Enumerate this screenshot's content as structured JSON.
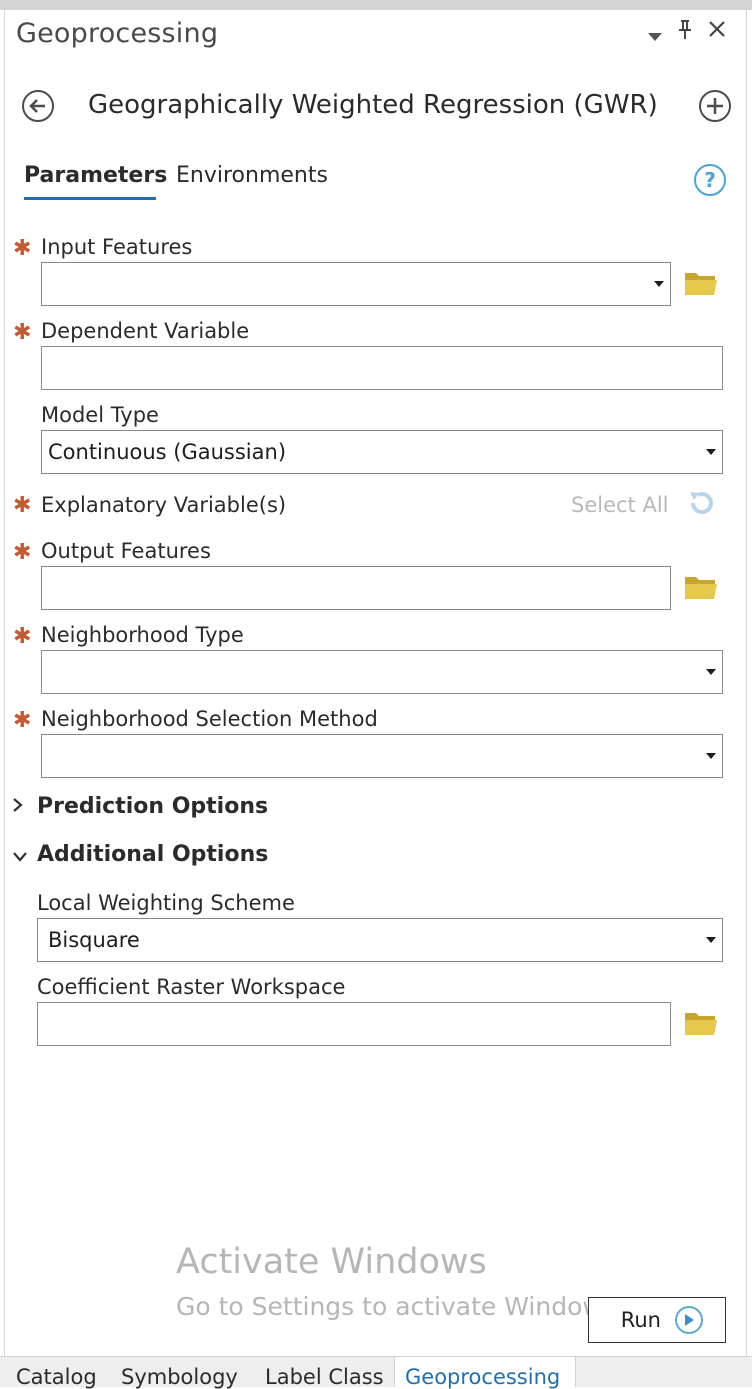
{
  "pane": {
    "title": "Geoprocessing",
    "controls": [
      "dropdown-icon",
      "pin-icon",
      "close-icon"
    ]
  },
  "tool": {
    "title": "Geographically Weighted Regression (GWR)"
  },
  "tabs": {
    "parameters": "Parameters",
    "environments": "Environments",
    "active": "Parameters"
  },
  "help_symbol": "?",
  "parameters": {
    "input_features": {
      "label": "Input Features",
      "value": ""
    },
    "dependent_variable": {
      "label": "Dependent Variable",
      "value": ""
    },
    "model_type": {
      "label": "Model Type",
      "value": "Continuous (Gaussian)"
    },
    "explanatory_variables": {
      "label": "Explanatory Variable(s)",
      "select_all": "Select All"
    },
    "output_features": {
      "label": "Output Features",
      "value": ""
    },
    "neighborhood_type": {
      "label": "Neighborhood Type",
      "value": ""
    },
    "neighborhood_selection_method": {
      "label": "Neighborhood Selection Method",
      "value": ""
    }
  },
  "sections": {
    "prediction_options": "Prediction Options",
    "additional_options": "Additional Options"
  },
  "additional": {
    "local_weighting_scheme": {
      "label": "Local Weighting Scheme",
      "value": "Bisquare"
    },
    "coefficient_raster_workspace": {
      "label": "Coefficient Raster Workspace",
      "value": ""
    }
  },
  "watermark": {
    "line1": "Activate Windows",
    "line2": "Go to Settings to activate Windows."
  },
  "run_button": {
    "label": "Run"
  },
  "bottom_tabs": [
    "Catalog",
    "Symbology",
    "Label Class",
    "Geoprocessing"
  ],
  "colors": {
    "accent": "#1f6fb2",
    "required": "#c45a33",
    "folder": "#d9b93a",
    "help": "#4aa3d9"
  }
}
